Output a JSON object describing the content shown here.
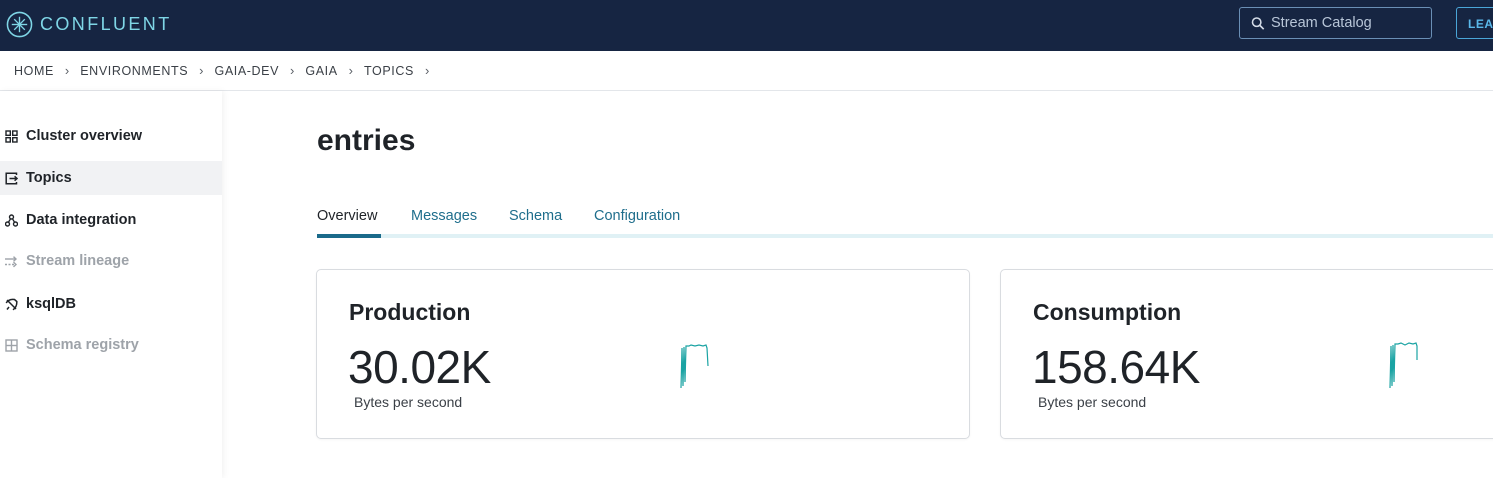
{
  "header": {
    "brand": "CONFLUENT",
    "search_placeholder": "Stream Catalog",
    "learn_label": "LEARN"
  },
  "breadcrumb": [
    "HOME",
    "ENVIRONMENTS",
    "GAIA-DEV",
    "GAIA",
    "TOPICS"
  ],
  "breadcrumb_sep": "›",
  "sidebar": {
    "items": [
      {
        "label": "Cluster overview",
        "icon": "grid-icon",
        "state": "normal"
      },
      {
        "label": "Topics",
        "icon": "topic-icon",
        "state": "active"
      },
      {
        "label": "Data integration",
        "icon": "connector-icon",
        "state": "normal"
      },
      {
        "label": "Stream lineage",
        "icon": "lineage-icon",
        "state": "disabled"
      },
      {
        "label": "ksqlDB",
        "icon": "ksqldb-icon",
        "state": "normal"
      },
      {
        "label": "Schema registry",
        "icon": "schema-icon",
        "state": "disabled"
      }
    ]
  },
  "main": {
    "title": "entries",
    "tabs": [
      {
        "label": "Overview",
        "active": true
      },
      {
        "label": "Messages",
        "active": false
      },
      {
        "label": "Schema",
        "active": false
      },
      {
        "label": "Configuration",
        "active": false
      }
    ],
    "cards": [
      {
        "title": "Production",
        "value": "30.02K",
        "unit": "Bytes per second"
      },
      {
        "title": "Consumption",
        "value": "158.64K",
        "unit": "Bytes per second"
      }
    ]
  },
  "colors": {
    "topbar": "#162542",
    "accent": "#1a6a8a",
    "sparkline": "#1aa3a3"
  }
}
